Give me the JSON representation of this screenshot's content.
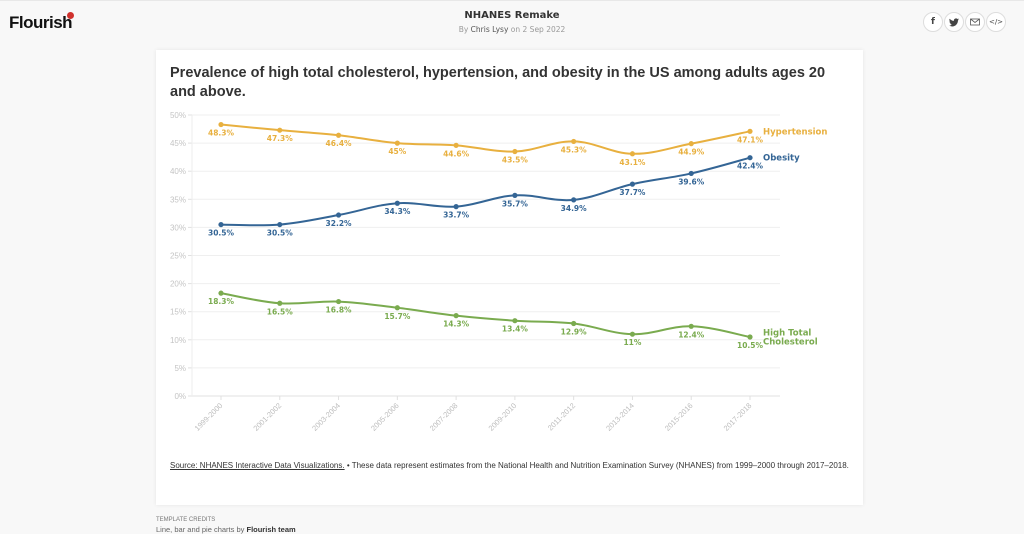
{
  "app": {
    "logo_text": "Flourish",
    "title": "NHANES Remake",
    "byline_prefix": "By",
    "author": "Chris Lysy",
    "byline_suffix": "on 2 Sep 2022",
    "share_buttons": [
      {
        "name": "facebook-icon",
        "glyph": "f"
      },
      {
        "name": "twitter-icon",
        "glyph": "🐦"
      },
      {
        "name": "email-icon",
        "glyph": "✉"
      },
      {
        "name": "embed-icon",
        "glyph": "</>"
      }
    ]
  },
  "footer": {
    "source_link": "Source: NHANES Interactive Data Visualizations.",
    "bullet": " • ",
    "note": "These data represent estimates from the National Health and Nutrition Examination Survey (NHANES) from 1999–2000 through 2017–2018."
  },
  "credits": {
    "heading": "TEMPLATE CREDITS",
    "prefix": "Line, bar and pie charts by ",
    "team": "Flourish team"
  },
  "chart_data": {
    "type": "line",
    "title": "Prevalence of high total cholesterol, hypertension, and obesity in the US among adults ages 20 and above.",
    "xlabel": "",
    "ylabel": "",
    "categories": [
      "1999-2000",
      "2001-2002",
      "2003-2004",
      "2005-2006",
      "2007-2008",
      "2009-2010",
      "2011-2012",
      "2013-2014",
      "2015-2016",
      "2017-2018"
    ],
    "ylim": [
      0,
      50
    ],
    "yticks": [
      0,
      5,
      10,
      15,
      20,
      25,
      30,
      35,
      40,
      45,
      50
    ],
    "ytick_suffix": "%",
    "grid": true,
    "legend": "inline-right",
    "series": [
      {
        "name": "Hypertension",
        "label_lines": [
          "Hypertension"
        ],
        "color": "#e8b03f",
        "values": [
          48.3,
          47.3,
          46.4,
          45,
          44.6,
          43.5,
          45.3,
          43.1,
          44.9,
          47.1
        ],
        "data_labels": [
          "48.3%",
          "47.3%",
          "46.4%",
          "45%",
          "44.6%",
          "43.5%",
          "45.3%",
          "43.1%",
          "44.9%",
          "47.1%"
        ]
      },
      {
        "name": "Obesity",
        "label_lines": [
          "Obesity"
        ],
        "color": "#346595",
        "values": [
          30.5,
          30.5,
          32.2,
          34.3,
          33.7,
          35.7,
          34.9,
          37.7,
          39.6,
          42.4
        ],
        "data_labels": [
          "30.5%",
          "30.5%",
          "32.2%",
          "34.3%",
          "33.7%",
          "35.7%",
          "34.9%",
          "37.7%",
          "39.6%",
          "42.4%"
        ]
      },
      {
        "name": "High Total Cholesterol",
        "label_lines": [
          "High Total",
          "Cholesterol"
        ],
        "color": "#7aab4f",
        "values": [
          18.3,
          16.5,
          16.8,
          15.7,
          14.3,
          13.4,
          12.9,
          11,
          12.4,
          10.5
        ],
        "data_labels": [
          "18.3%",
          "16.5%",
          "16.8%",
          "15.7%",
          "14.3%",
          "13.4%",
          "12.9%",
          "11%",
          "12.4%",
          "10.5%"
        ]
      }
    ]
  }
}
